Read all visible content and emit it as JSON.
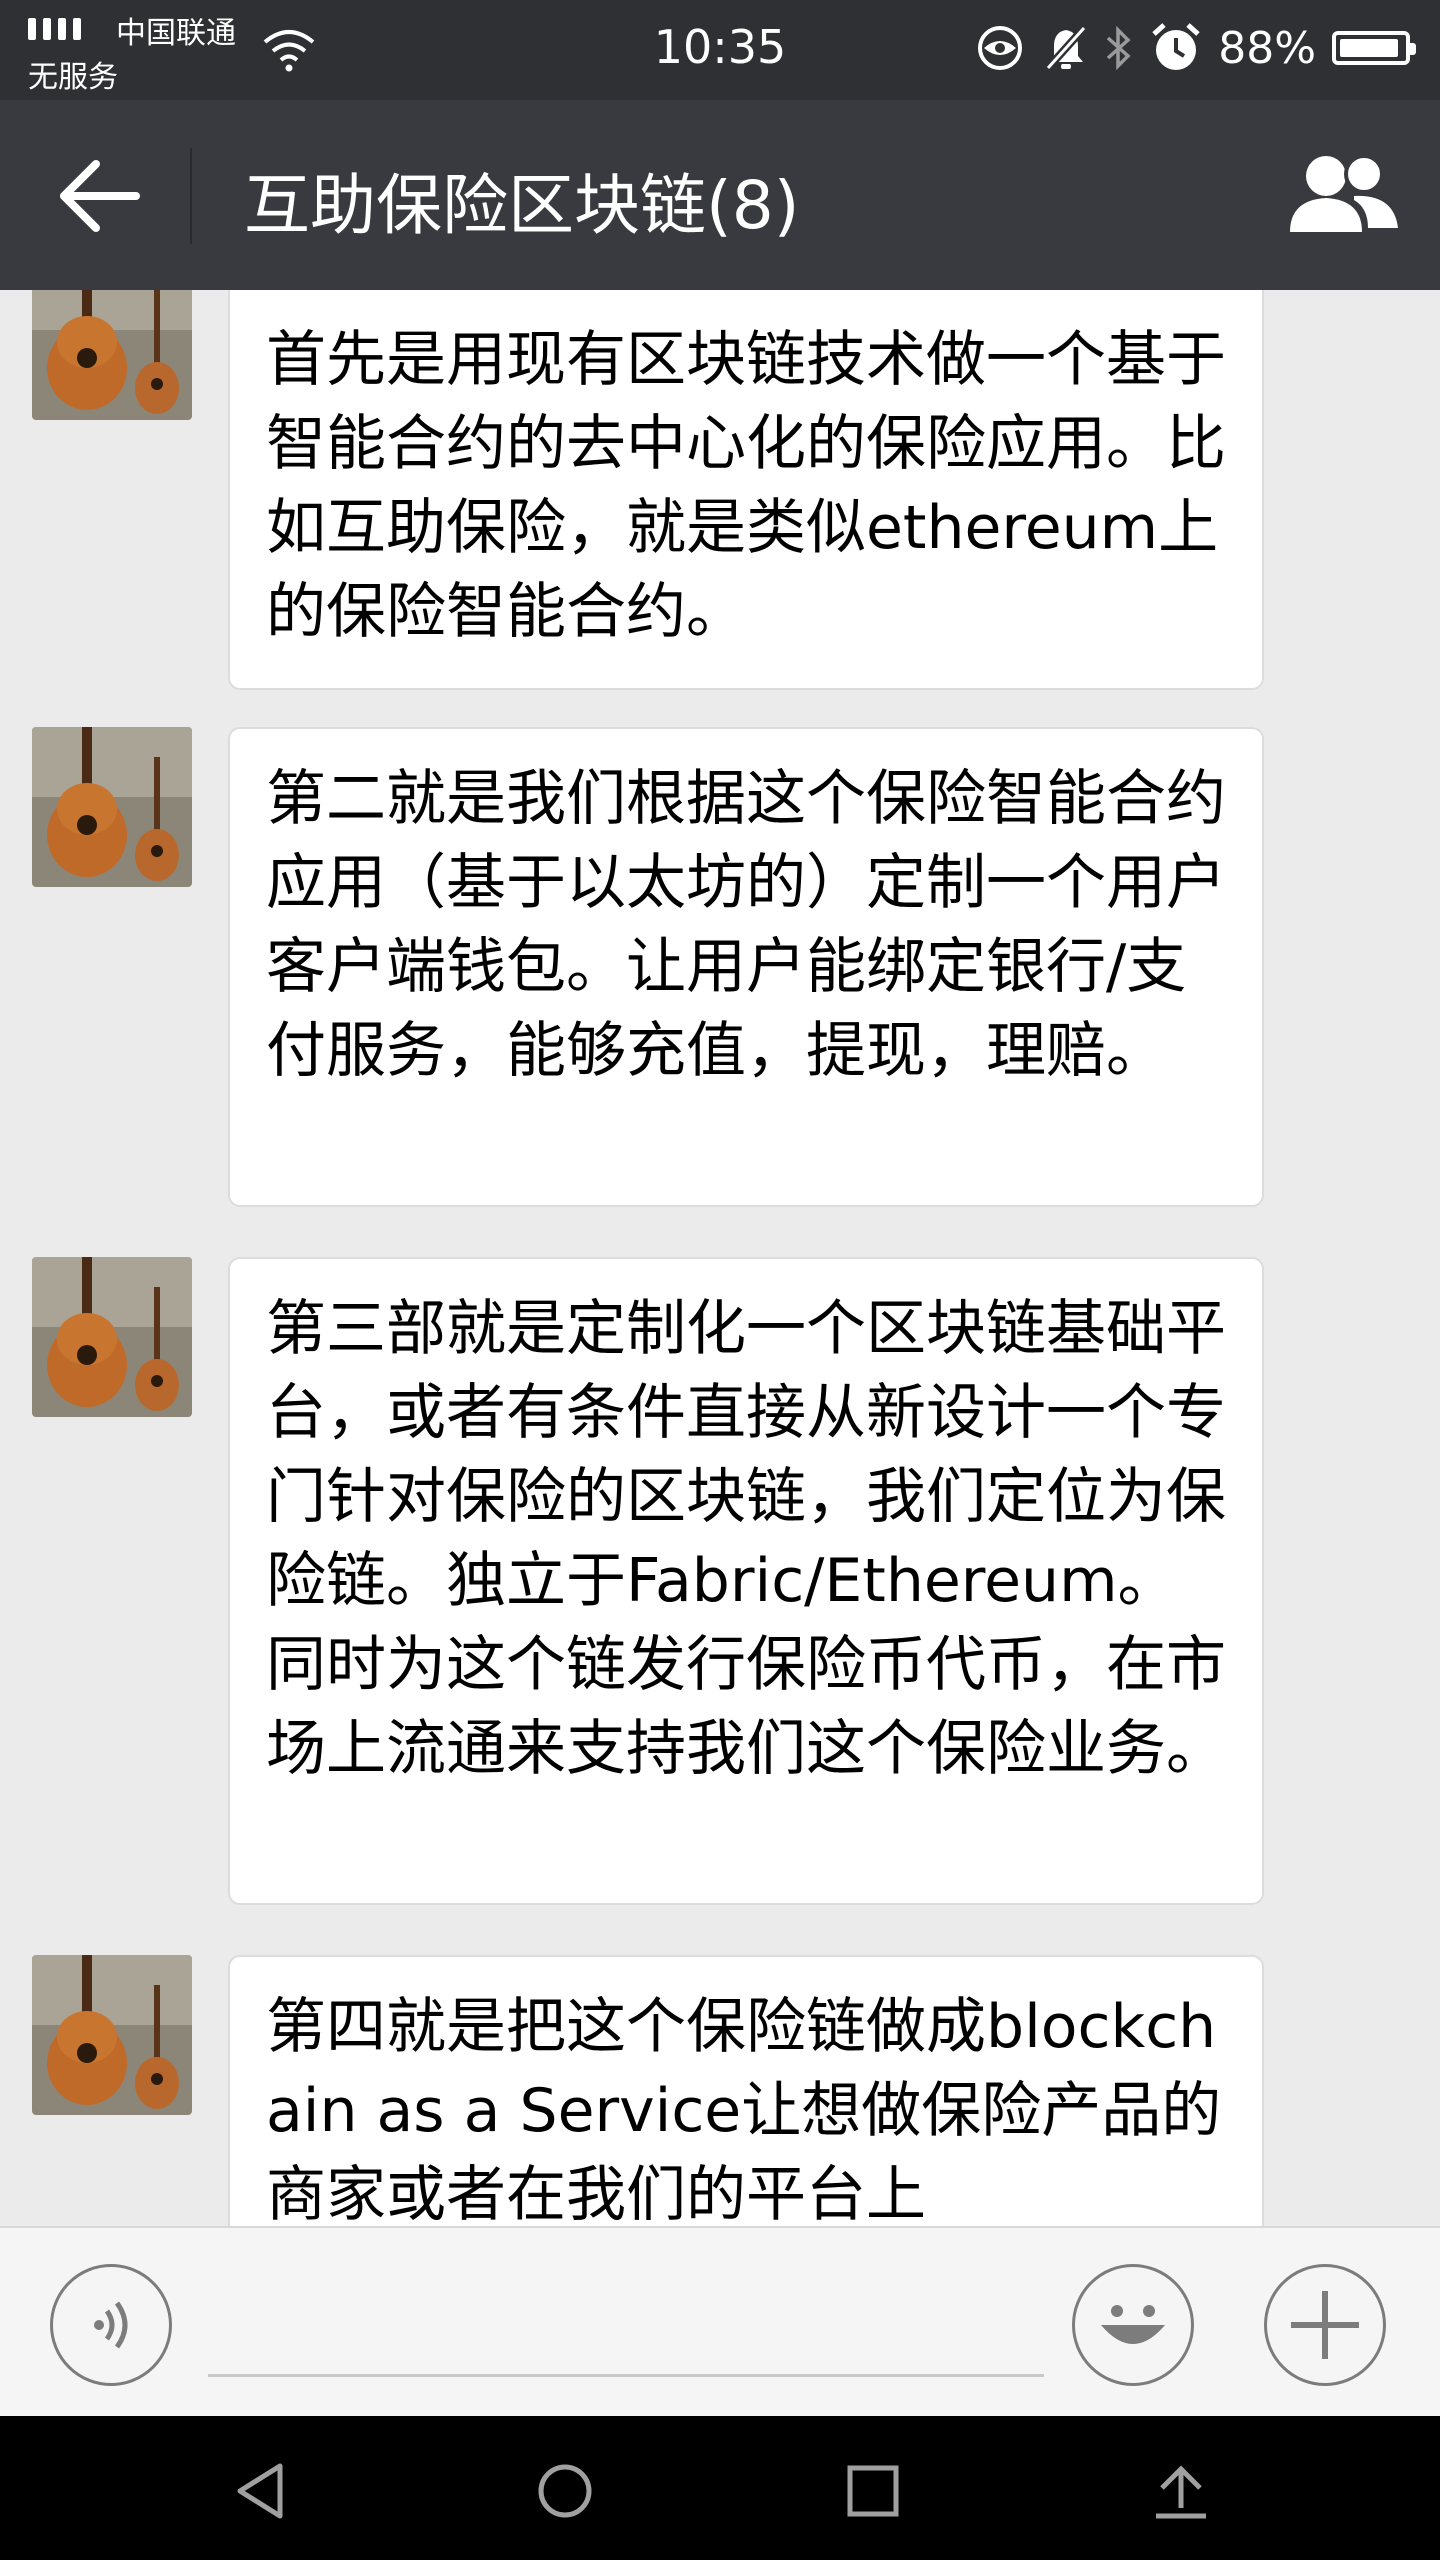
{
  "status_bar": {
    "carrier": "中国联通",
    "service": "无服务",
    "time": "10:35",
    "battery_percent": "88%",
    "battery_level": 0.88
  },
  "header": {
    "title": "互助保险区块链(8)"
  },
  "messages": [
    {
      "text": "首先是用现有区块链技术做一个基于智能合约的去中心化的保险应用。比如互助保险，就是类似ethereum上的保险智能合约。"
    },
    {
      "text": "第二就是我们根据这个保险智能合约应用（基于以太坊的）定制一个用户客户端钱包。让用户能绑定银行/支付服务，能够充值，提现，理赔。"
    },
    {
      "text": "第三部就是定制化一个区块链基础平台，或者有条件直接从新设计一个专门针对保险的区块链，我们定位为保险链。独立于Fabric/Ethereum。同时为这个链发行保险币代币，在市场上流通来支持我们这个保险业务。"
    },
    {
      "text": "第四就是把这个保险链做成blockchain as a Service让想做保险产品的商家或者在我们的平台上"
    }
  ],
  "icons": {
    "back": "arrow-left-icon",
    "group": "group-members-icon",
    "voice": "voice-input-icon",
    "emoji": "emoji-icon",
    "more": "plus-icon"
  },
  "colors": {
    "title_bar": "#393a3f",
    "status_bar": "#2e3033",
    "chat_background": "#ebebeb",
    "bubble": "#ffffff"
  }
}
